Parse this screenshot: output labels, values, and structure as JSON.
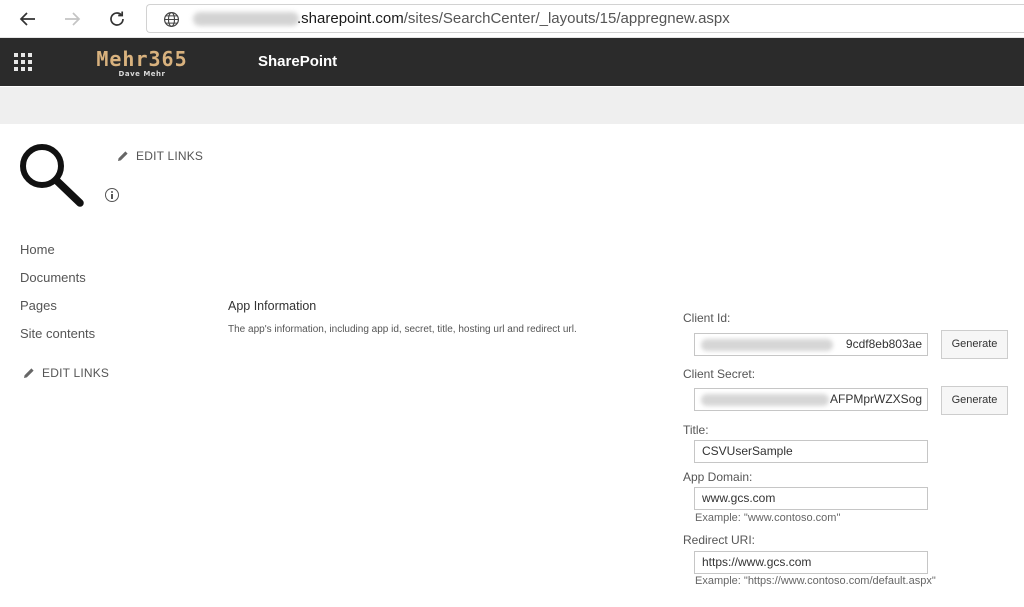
{
  "browser": {
    "url_host": ".sharepoint.com",
    "url_path": "/sites/SearchCenter/_layouts/15/appregnew.aspx"
  },
  "suite": {
    "brand_name": "Mehr365",
    "brand_sub": "Dave Mehr",
    "app_name": "SharePoint"
  },
  "left_nav": {
    "edit_links_top": "EDIT LINKS",
    "items": [
      "Home",
      "Documents",
      "Pages",
      "Site contents"
    ],
    "edit_links_bottom": "EDIT LINKS"
  },
  "section": {
    "title": "App Information",
    "description": "The app's information, including app id, secret, title, hosting url and redirect url."
  },
  "form": {
    "client_id": {
      "label": "Client Id:",
      "value_tail": "9cdf8eb803ae",
      "button": "Generate"
    },
    "client_secret": {
      "label": "Client Secret:",
      "value_tail": "AFPMprWZXSog",
      "button": "Generate"
    },
    "title": {
      "label": "Title:",
      "value": "CSVUserSample"
    },
    "app_domain": {
      "label": "App Domain:",
      "value": "www.gcs.com",
      "example": "Example: \"www.contoso.com\""
    },
    "redirect_uri": {
      "label": "Redirect URI:",
      "value": "https://www.gcs.com",
      "example": "Example: \"https://www.contoso.com/default.aspx\""
    }
  },
  "icons": {
    "back": "back-arrow-icon",
    "forward": "forward-arrow-icon",
    "refresh": "refresh-icon",
    "site": "globe-icon",
    "app_launcher": "waffle-icon",
    "site_logo": "magnifier-icon",
    "edit": "pencil-icon",
    "info": "info-icon"
  }
}
